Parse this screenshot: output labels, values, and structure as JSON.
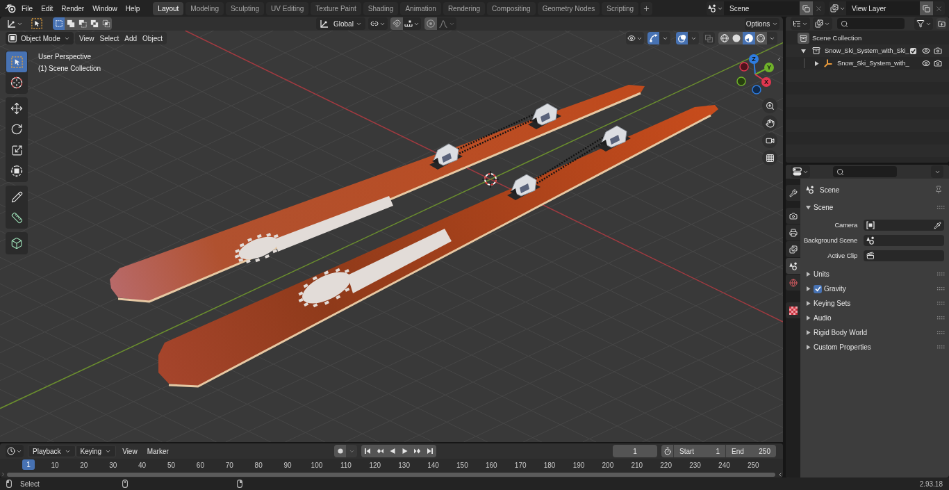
{
  "menu_bar": {
    "menus": [
      "File",
      "Edit",
      "Render",
      "Window",
      "Help"
    ]
  },
  "workspaces": [
    {
      "label": "Layout",
      "selected": true
    },
    {
      "label": "Modeling",
      "selected": false
    },
    {
      "label": "Sculpting",
      "selected": false
    },
    {
      "label": "UV Editing",
      "selected": false
    },
    {
      "label": "Texture Paint",
      "selected": false
    },
    {
      "label": "Shading",
      "selected": false
    },
    {
      "label": "Animation",
      "selected": false
    },
    {
      "label": "Rendering",
      "selected": false
    },
    {
      "label": "Compositing",
      "selected": false
    },
    {
      "label": "Geometry Nodes",
      "selected": false
    },
    {
      "label": "Scripting",
      "selected": false
    }
  ],
  "scene_selector": {
    "value": "Scene"
  },
  "view_layer_selector": {
    "value": "View Layer"
  },
  "tool_settings": {
    "select_modes": [
      {
        "kind": "new",
        "selected": true
      },
      {
        "kind": "extend",
        "selected": false
      },
      {
        "kind": "subtract",
        "selected": false
      },
      {
        "kind": "invert",
        "selected": false
      },
      {
        "kind": "intersect",
        "selected": false
      }
    ],
    "orientation": "Global",
    "options": "Options"
  },
  "viewport_header": {
    "mode": "Object Mode",
    "menus": [
      "View",
      "Select",
      "Add",
      "Object"
    ],
    "gizmos": {
      "on": true
    },
    "overlays": {
      "on": true
    },
    "xray": {
      "on": false
    },
    "shading_modes": [
      {
        "kind": "wireframe",
        "selected": false
      },
      {
        "kind": "solid",
        "selected": false
      },
      {
        "kind": "material",
        "selected": true
      },
      {
        "kind": "rendered",
        "selected": false
      }
    ]
  },
  "toolbar": {
    "groups": [
      {
        "tools": [
          {
            "kind": "select_box",
            "selected": true
          },
          {
            "kind": "cursor",
            "selected": false
          }
        ]
      },
      {
        "tools": [
          {
            "kind": "move",
            "selected": false
          },
          {
            "kind": "rotate",
            "selected": false
          },
          {
            "kind": "scale",
            "selected": false
          },
          {
            "kind": "transform",
            "selected": false
          }
        ]
      },
      {
        "tools": [
          {
            "kind": "annotate",
            "selected": false
          },
          {
            "kind": "measure",
            "selected": false
          }
        ]
      },
      {
        "tools": [
          {
            "kind": "add_cube",
            "selected": false
          }
        ]
      }
    ]
  },
  "viewport": {
    "view_name": "User Perspective",
    "collection": "(1) Scene Collection",
    "gizmo_axes": [
      {
        "label": "Z",
        "color": "#2e7ce0"
      },
      {
        "label": "Y",
        "color": "#6fb12a"
      },
      {
        "label": "X",
        "color": "#e0364f"
      }
    ]
  },
  "outliner": {
    "root": "Scene Collection",
    "items": [
      {
        "label": "Snow_Ski_System_with_Ski_",
        "kind": "collection",
        "expanded": true,
        "checked": true,
        "children": [
          {
            "label": "Snow_Ski_System_with_",
            "kind": "object",
            "expanded": false
          }
        ]
      }
    ]
  },
  "properties": {
    "tab_groups": [
      {
        "tabs": [
          {
            "kind": "tool",
            "selected": false
          }
        ]
      },
      {
        "tabs": [
          {
            "kind": "render",
            "selected": false
          },
          {
            "kind": "output",
            "selected": false
          },
          {
            "kind": "view_layer",
            "selected": false
          },
          {
            "kind": "scene",
            "selected": true
          },
          {
            "kind": "world",
            "selected": false
          }
        ]
      },
      {
        "tabs": [
          {
            "kind": "texture",
            "selected": false
          }
        ]
      }
    ],
    "context": "Scene",
    "panels": [
      {
        "title": "Scene",
        "expanded": true,
        "fields": [
          {
            "label": "Camera",
            "kind": "camera"
          },
          {
            "label": "Background Scene",
            "kind": "scene"
          },
          {
            "label": "Active Clip",
            "kind": "clip"
          }
        ]
      },
      {
        "title": "Units",
        "expanded": false
      },
      {
        "title": "Gravity",
        "expanded": false,
        "toggle": {
          "checked": true
        }
      },
      {
        "title": "Keying Sets",
        "expanded": false
      },
      {
        "title": "Audio",
        "expanded": false
      },
      {
        "title": "Rigid Body World",
        "expanded": false
      },
      {
        "title": "Custom Properties",
        "expanded": false
      }
    ]
  },
  "timeline": {
    "menus": [
      {
        "label": "Playback",
        "kind": "dropdown"
      },
      {
        "label": "Keying",
        "kind": "dropdown"
      },
      {
        "label": "View",
        "kind": "menu"
      },
      {
        "label": "Marker",
        "kind": "menu"
      }
    ],
    "current_frame": "1",
    "start": {
      "label": "Start",
      "value": "1"
    },
    "end": {
      "label": "End",
      "value": "250"
    },
    "playhead": "1",
    "ruler": [
      "10",
      "20",
      "30",
      "40",
      "50",
      "60",
      "70",
      "80",
      "90",
      "100",
      "110",
      "120",
      "130",
      "140",
      "150",
      "160",
      "170",
      "180",
      "190",
      "200",
      "210",
      "220",
      "230",
      "240",
      "250"
    ]
  },
  "status_bar": {
    "hint": "Select",
    "version": "2.93.18"
  }
}
